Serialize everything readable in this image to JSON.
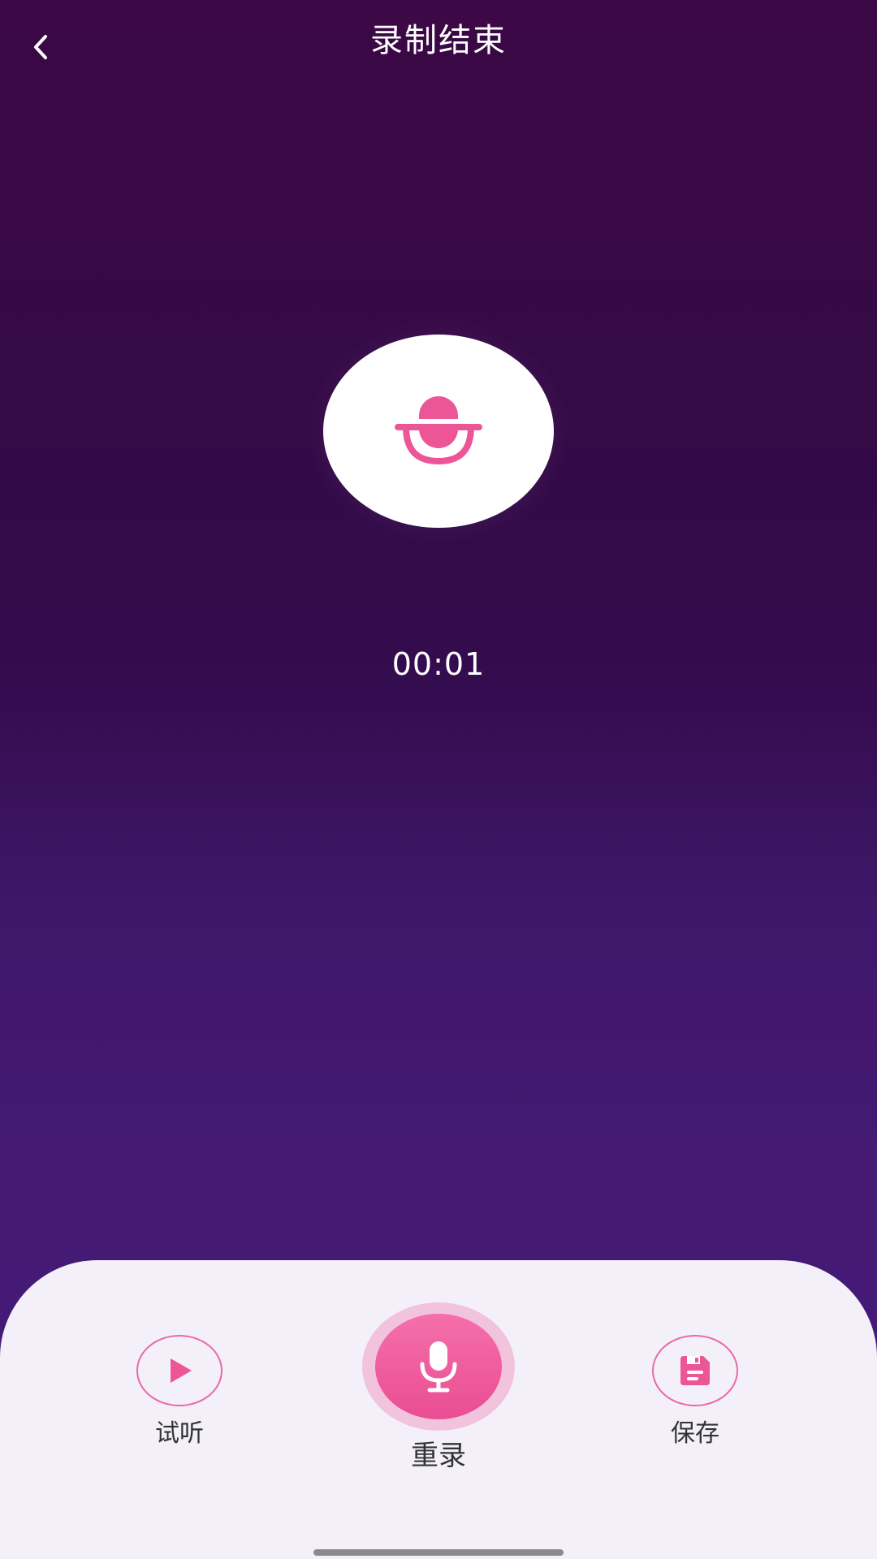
{
  "header": {
    "title": "录制结束",
    "back_icon": "chevron-left-icon"
  },
  "recorder": {
    "mic_icon": "microphone-icon",
    "elapsed": "00:01"
  },
  "controls": {
    "preview": {
      "label": "试听",
      "icon": "play-icon"
    },
    "rerecord": {
      "label": "重录",
      "icon": "microphone-icon"
    },
    "save": {
      "label": "保存",
      "icon": "save-icon"
    }
  },
  "colors": {
    "accent": "#ec5596",
    "background_top": "#3c0846",
    "background_bottom": "#451b7c",
    "panel": "#f4f0f9"
  }
}
